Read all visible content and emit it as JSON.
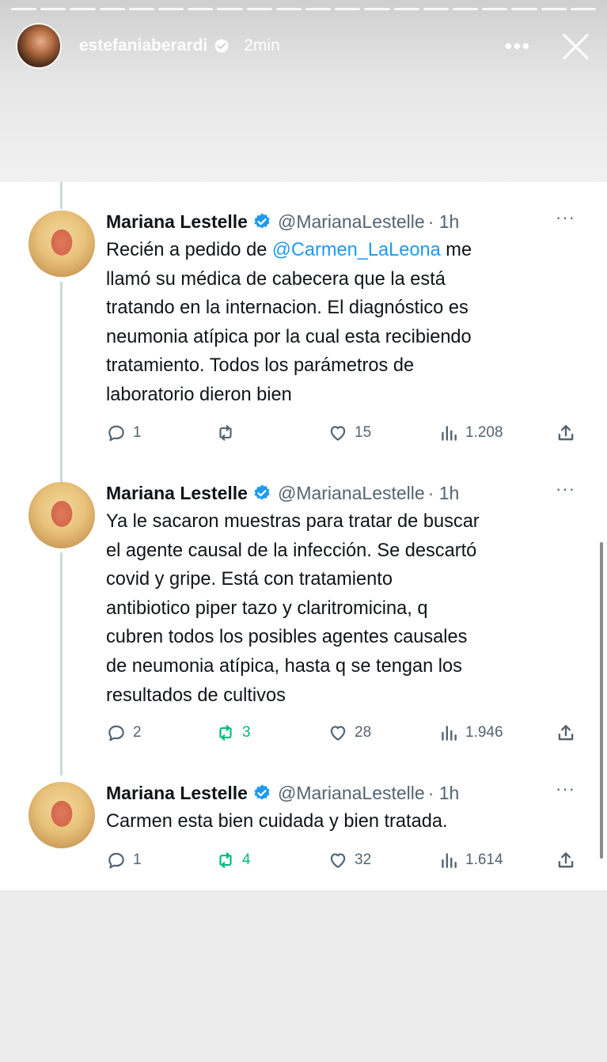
{
  "story": {
    "username": "estefaniaberardi",
    "time": "2min",
    "more_label": "•••"
  },
  "tweets": [
    {
      "name": "Mariana Lestelle",
      "handle": "@MarianaLestelle",
      "time": "· 1h",
      "more": "···",
      "lines": [
        [
          "Recién  a pedido de ",
          "@Carmen_LaLeona",
          " me"
        ],
        "llamó su médica de cabecera que la está",
        "tratando en la internacion.  El diagnóstico es",
        "neumonia atípica por la cual esta recibiendo",
        "tratamiento. Todos los parámetros de",
        "laboratorio dieron bien"
      ],
      "replies": "1",
      "retweets": "",
      "likes": "15",
      "views": "1.208"
    },
    {
      "name": "Mariana Lestelle",
      "handle": "@MarianaLestelle",
      "time": "· 1h",
      "more": "···",
      "lines": [
        "Ya le sacaron muestras para tratar de buscar",
        "el agente causal de la infección. Se descartó",
        "covid y gripe. Está con tratamiento",
        "antibiotico  piper tazo y claritromicina, q",
        "cubren todos los posibles agentes causales",
        "de neumonia atípica, hasta q se tengan los",
        "resultados de cultivos"
      ],
      "replies": "2",
      "retweets": "3",
      "likes": "28",
      "views": "1.946"
    },
    {
      "name": "Mariana Lestelle",
      "handle": "@MarianaLestelle",
      "time": "· 1h",
      "more": "···",
      "lines": [
        "Carmen esta bien cuidada y bien tratada."
      ],
      "replies": "1",
      "retweets": "4",
      "likes": "32",
      "views": "1.614"
    }
  ]
}
